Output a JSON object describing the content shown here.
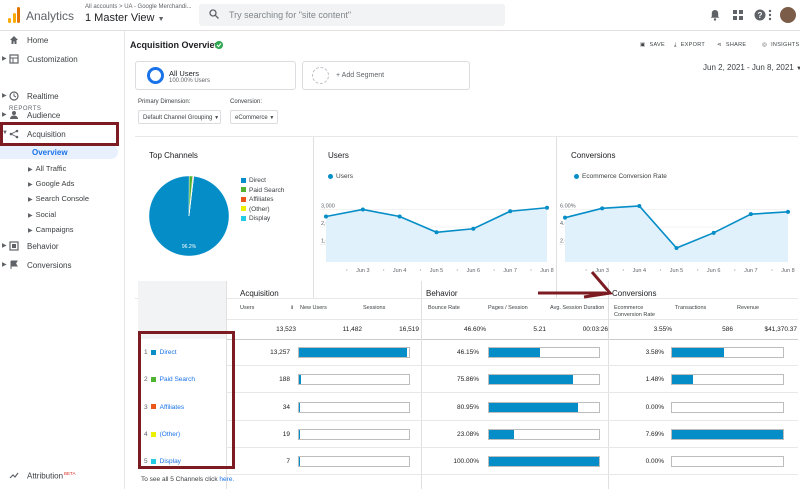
{
  "topbar": {
    "app_name": "Analytics",
    "account_path": "All accounts > UA - Google Merchandi...",
    "view_name": "1 Master View",
    "search_placeholder": "Try searching for \"site content\""
  },
  "sidebar": {
    "home": "Home",
    "customization": "Customization",
    "reports_header": "REPORTS",
    "realtime": "Realtime",
    "audience": "Audience",
    "acquisition": "Acquisition",
    "overview": "Overview",
    "sub_items": [
      "All Traffic",
      "Google Ads",
      "Search Console",
      "Social",
      "Campaigns"
    ],
    "behavior": "Behavior",
    "conversions": "Conversions",
    "attribution": "Attribution",
    "attribution_badge": "BETA"
  },
  "page": {
    "title": "Acquisition Overview",
    "actions": [
      "SAVE",
      "EXPORT",
      "SHARE",
      "INSIGHTS"
    ],
    "segment_name": "All Users",
    "segment_sub": "100.00% Users",
    "add_segment": "+ Add Segment",
    "date_range": "Jun 2, 2021 - Jun 8, 2021",
    "primary_dimension_label": "Primary Dimension:",
    "primary_dimension_value": "Default Channel Grouping",
    "conversion_label": "Conversion:",
    "conversion_value": "eCommerce"
  },
  "cards": {
    "top_channels": {
      "title": "Top Channels",
      "legend": [
        {
          "name": "Direct",
          "color": "#058dc7"
        },
        {
          "name": "Paid Search",
          "color": "#50b432"
        },
        {
          "name": "Affiliates",
          "color": "#ed561b"
        },
        {
          "name": "(Other)",
          "color": "#edef00"
        },
        {
          "name": "Display",
          "color": "#24cbe5"
        }
      ],
      "pie_label": "96.2%"
    },
    "users": {
      "title": "Users",
      "legend": "Users"
    },
    "conversions": {
      "title": "Conversions",
      "legend": "Ecommerce Conversion Rate"
    }
  },
  "chart_data": [
    {
      "type": "pie",
      "title": "Top Channels",
      "labels": [
        "Direct",
        "Paid Search",
        "Affiliates",
        "(Other)",
        "Display"
      ],
      "values": [
        13257,
        188,
        34,
        19,
        7
      ],
      "colors": [
        "#058dc7",
        "#50b432",
        "#ed561b",
        "#edef00",
        "#24cbe5"
      ]
    },
    {
      "type": "area",
      "title": "Users",
      "x": [
        "Jun 2",
        "Jun 3",
        "Jun 4",
        "Jun 5",
        "Jun 6",
        "Jun 7",
        "Jun 8"
      ],
      "x_tick_labels": [
        "Jun 3",
        "Jun 4",
        "Jun 5",
        "Jun 6",
        "Jun 7",
        "Jun 8"
      ],
      "series": [
        {
          "name": "Users",
          "values": [
            2600,
            3000,
            2600,
            1700,
            1900,
            2900,
            3100
          ]
        }
      ],
      "y_ticks": [
        "3,000",
        "2,000",
        "1,000"
      ],
      "ylim": [
        0,
        4000
      ]
    },
    {
      "type": "area",
      "title": "Conversions",
      "x": [
        "Jun 2",
        "Jun 3",
        "Jun 4",
        "Jun 5",
        "Jun 6",
        "Jun 7",
        "Jun 8"
      ],
      "x_tick_labels": [
        "Jun 3",
        "Jun 4",
        "Jun 5",
        "Jun 6",
        "Jun 7",
        "Jun 8"
      ],
      "series": [
        {
          "name": "Ecommerce Conversion Rate",
          "values": [
            3.8,
            4.6,
            4.8,
            1.2,
            2.5,
            4.1,
            4.3
          ]
        }
      ],
      "y_ticks": [
        "6.00%",
        "4.00%",
        "2.00%"
      ],
      "ylim": [
        0,
        6
      ]
    }
  ],
  "table": {
    "groups": [
      "Acquisition",
      "Behavior",
      "Conversions"
    ],
    "columns": [
      "Users",
      "New Users",
      "Sessions",
      "Bounce Rate",
      "Pages / Session",
      "Avg. Session Duration",
      "Ecommerce Conversion Rate",
      "Transactions",
      "Revenue"
    ],
    "totals": [
      "13,523",
      "11,482",
      "16,519",
      "46.60%",
      "5.21",
      "00:03:26",
      "3.55%",
      "586",
      "$41,370.37"
    ],
    "rows": [
      {
        "num": "1",
        "name": "Direct",
        "color": "#058dc7",
        "users": "13,257",
        "bounce": "46.15%",
        "conv": "3.58%",
        "users_fill": 0.98,
        "bounce_fill": 0.46,
        "conv_fill": 0.47
      },
      {
        "num": "2",
        "name": "Paid Search",
        "color": "#50b432",
        "users": "188",
        "bounce": "75.86%",
        "conv": "1.48%",
        "users_fill": 0.014,
        "bounce_fill": 0.76,
        "conv_fill": 0.19
      },
      {
        "num": "3",
        "name": "Affiliates",
        "color": "#ed561b",
        "users": "34",
        "bounce": "80.95%",
        "conv": "0.00%",
        "users_fill": 0.003,
        "bounce_fill": 0.81,
        "conv_fill": 0.0
      },
      {
        "num": "4",
        "name": "(Other)",
        "color": "#edef00",
        "users": "19",
        "bounce": "23.08%",
        "conv": "7.69%",
        "users_fill": 0.002,
        "bounce_fill": 0.23,
        "conv_fill": 1.0
      },
      {
        "num": "5",
        "name": "Display",
        "color": "#24cbe5",
        "users": "7",
        "bounce": "100.00%",
        "conv": "0.00%",
        "users_fill": 0.001,
        "bounce_fill": 1.0,
        "conv_fill": 0.0
      }
    ],
    "footer_prefix": "To see all 5 Channels click",
    "footer_link": "here."
  }
}
